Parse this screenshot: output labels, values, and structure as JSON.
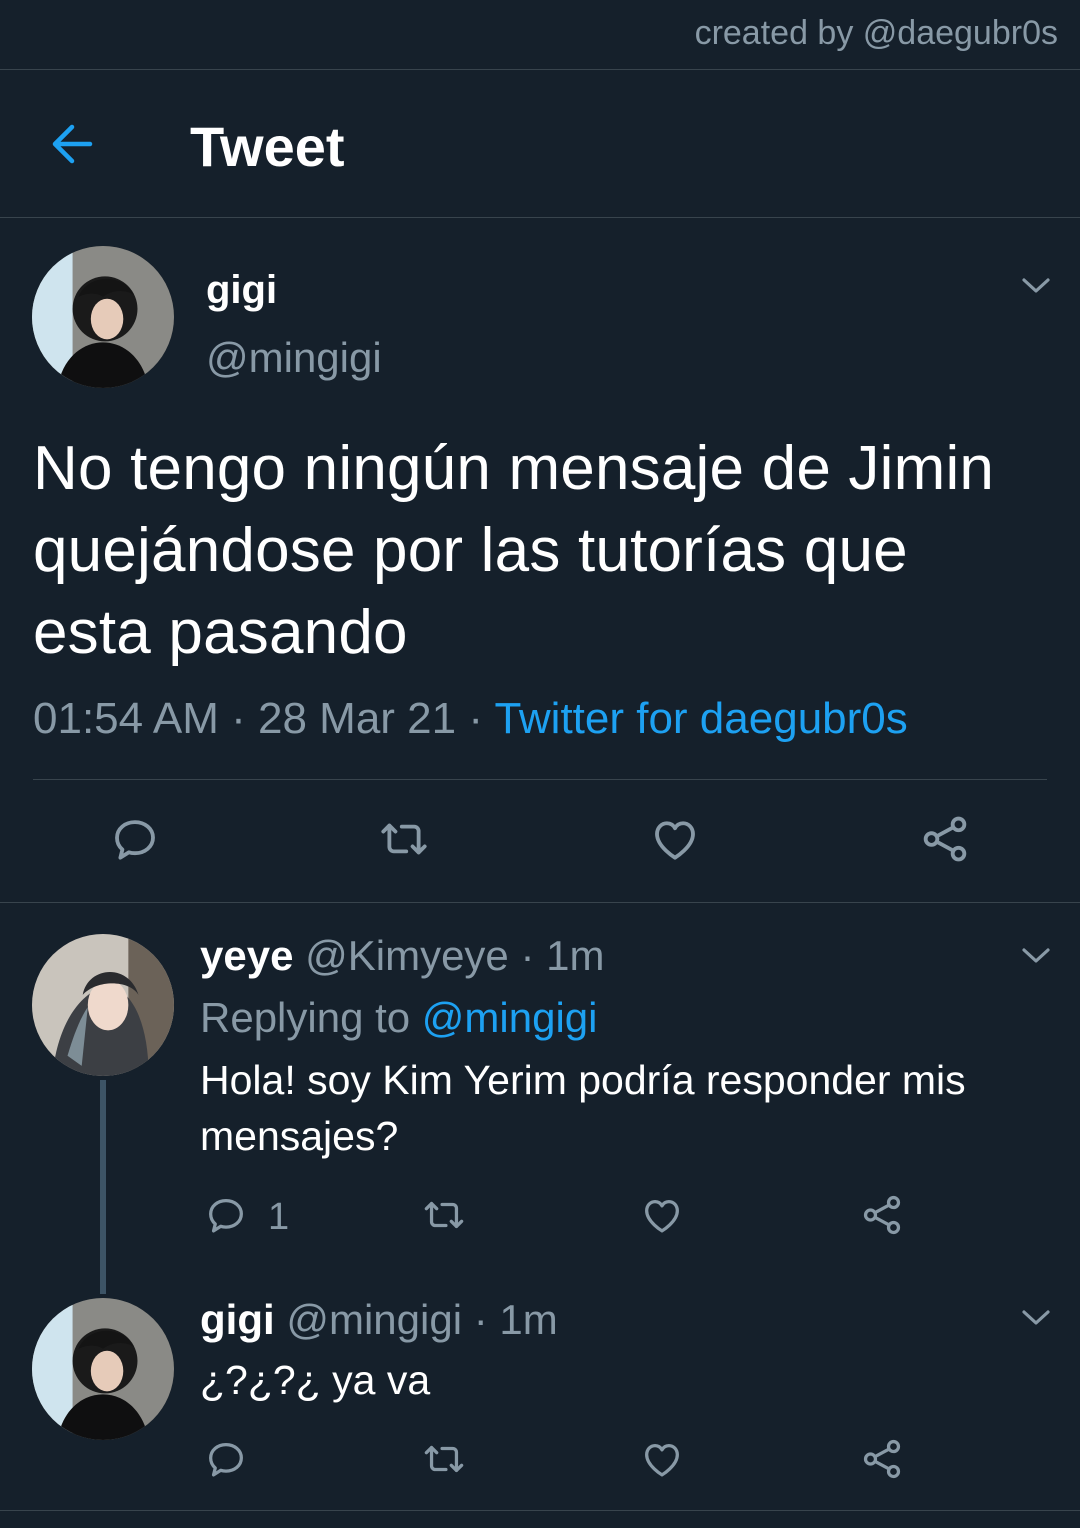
{
  "watermark": "created by @daegubr0s",
  "header": {
    "title": "Tweet"
  },
  "main_tweet": {
    "name": "gigi",
    "handle": "@mingigi",
    "text": "No tengo ningún mensaje de Jimin quejándose por las tutorías que esta pasando",
    "time": "01:54 AM",
    "date": "28 Mar 21",
    "separator": " · ",
    "source": "Twitter for daegubr0s"
  },
  "replies": [
    {
      "name": "yeye",
      "handle": "@Kimyeye",
      "time": "· 1m",
      "replying_label": "Replying to",
      "replying_to": "@mingigi",
      "text": "Hola! soy Kim Yerim podría responder mis mensajes?",
      "reply_count": "1"
    },
    {
      "name": "gigi",
      "handle": "@mingigi",
      "time": "· 1m",
      "text": "¿?¿?¿ ya va"
    }
  ],
  "icons": [
    "back-arrow-icon",
    "chevron-down-icon",
    "reply-icon",
    "retweet-icon",
    "like-icon",
    "share-icon"
  ],
  "colors": {
    "background": "#15202b",
    "accent": "#1da1f2",
    "muted": "#8899a6",
    "divider": "#38444d"
  }
}
